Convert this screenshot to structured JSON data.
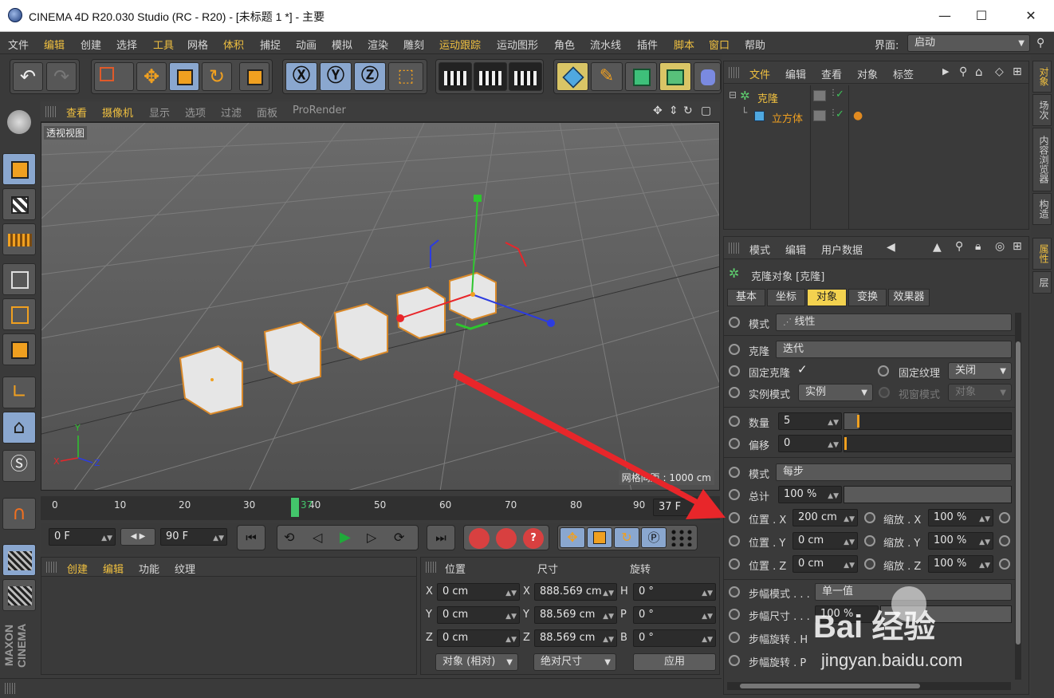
{
  "window": {
    "title": "CINEMA 4D R20.030 Studio (RC - R20) - [未标题 1 *] - 主要",
    "minimize": "—",
    "maximize": "☐",
    "close": "✕"
  },
  "menubar": {
    "items": [
      "文件",
      "编辑",
      "创建",
      "选择",
      "工具",
      "网格",
      "体积",
      "捕捉",
      "动画",
      "模拟",
      "渲染",
      "雕刻",
      "运动跟踪",
      "运动图形",
      "角色",
      "流水线",
      "插件",
      "脚本",
      "窗口",
      "帮助"
    ],
    "interface_label": "界面:",
    "interface_value": "启动"
  },
  "viewport": {
    "menu": [
      "查看",
      "摄像机",
      "显示",
      "选项",
      "过滤",
      "面板",
      "ProRender"
    ],
    "label": "透视视图",
    "grid_info": "网格间距 : 1000 cm",
    "axis_labels": {
      "x": "X",
      "y": "Y",
      "z": "Z"
    }
  },
  "timeline": {
    "ticks": [
      "0",
      "10",
      "20",
      "30",
      "40",
      "50",
      "60",
      "70",
      "80",
      "90"
    ],
    "current_frame": "37",
    "frame_display": "37 F",
    "start_field": "0 F",
    "end_field": "90 F"
  },
  "material_panel": {
    "menu": [
      "创建",
      "编辑",
      "功能",
      "纹理"
    ]
  },
  "coord_panel": {
    "headers": [
      "位置",
      "尺寸",
      "旋转"
    ],
    "rows": [
      {
        "pos_label": "X",
        "pos": "0 cm",
        "size_label": "X",
        "size": "888.569 cm",
        "rot_label": "H",
        "rot": "0 °"
      },
      {
        "pos_label": "Y",
        "pos": "0 cm",
        "size_label": "Y",
        "size": "88.569 cm",
        "rot_label": "P",
        "rot": "0 °"
      },
      {
        "pos_label": "Z",
        "pos": "0 cm",
        "size_label": "Z",
        "size": "88.569 cm",
        "rot_label": "B",
        "rot": "0 °"
      }
    ],
    "mode_dropdown": "对象 (相对)",
    "size_dropdown": "绝对尺寸",
    "apply_button": "应用"
  },
  "object_manager": {
    "menu": [
      "文件",
      "编辑",
      "查看",
      "对象",
      "标签"
    ],
    "objects": [
      {
        "name": "克隆",
        "level": 0
      },
      {
        "name": "立方体",
        "level": 1
      }
    ]
  },
  "side_tabs_top": [
    "对象",
    "场次",
    "内容浏览器",
    "构造"
  ],
  "side_tabs_bottom": [
    "属性",
    "层"
  ],
  "attributes": {
    "menu": [
      "模式",
      "编辑",
      "用户数据"
    ],
    "object_title": "克隆对象 [克隆]",
    "tabs": [
      "基本",
      "坐标",
      "对象",
      "变换",
      "效果器"
    ],
    "active_tab": "对象",
    "rows": {
      "mode_label": "模式",
      "mode_value": "线性",
      "clone_label": "克隆",
      "clone_value": "迭代",
      "fix_clone_label": "固定克隆",
      "fix_clone_check": "✓",
      "fix_texture_label": "固定纹理",
      "fix_texture_value": "关闭",
      "instance_mode_label": "实例模式",
      "instance_mode_value": "实例",
      "viewport_mode_label": "视窗模式",
      "viewport_mode_value": "对象",
      "count_label": "数量",
      "count_value": "5",
      "offset_label": "偏移",
      "offset_value": "0",
      "mode2_label": "模式",
      "mode2_value": "每步",
      "total_label": "总计",
      "total_value": "100 %",
      "pos_x_label": "位置 . X",
      "pos_x_value": "200 cm",
      "scale_x_label": "缩放 . X",
      "scale_x_value": "100 %",
      "pos_y_label": "位置 . Y",
      "pos_y_value": "0 cm",
      "scale_y_label": "缩放 . Y",
      "scale_y_value": "100 %",
      "pos_z_label": "位置 . Z",
      "pos_z_value": "0 cm",
      "scale_z_label": "缩放 . Z",
      "scale_z_value": "100 %",
      "step_mode_label": "步幅模式 . . .",
      "step_mode_value": "单一值",
      "step_size_label": "步幅尺寸 . . .",
      "step_size_value": "100 %",
      "step_rot_h_label": "步幅旋转 . H",
      "step_rot_p_label": "步幅旋转 . P"
    }
  },
  "watermark": {
    "text": "Bai 经验",
    "url": "jingyan.baidu.com"
  },
  "brand": "MAXON CINEMA",
  "colors": {
    "accent": "#f0c040",
    "selection": "#d9892a",
    "arrow": "#e8262a"
  }
}
